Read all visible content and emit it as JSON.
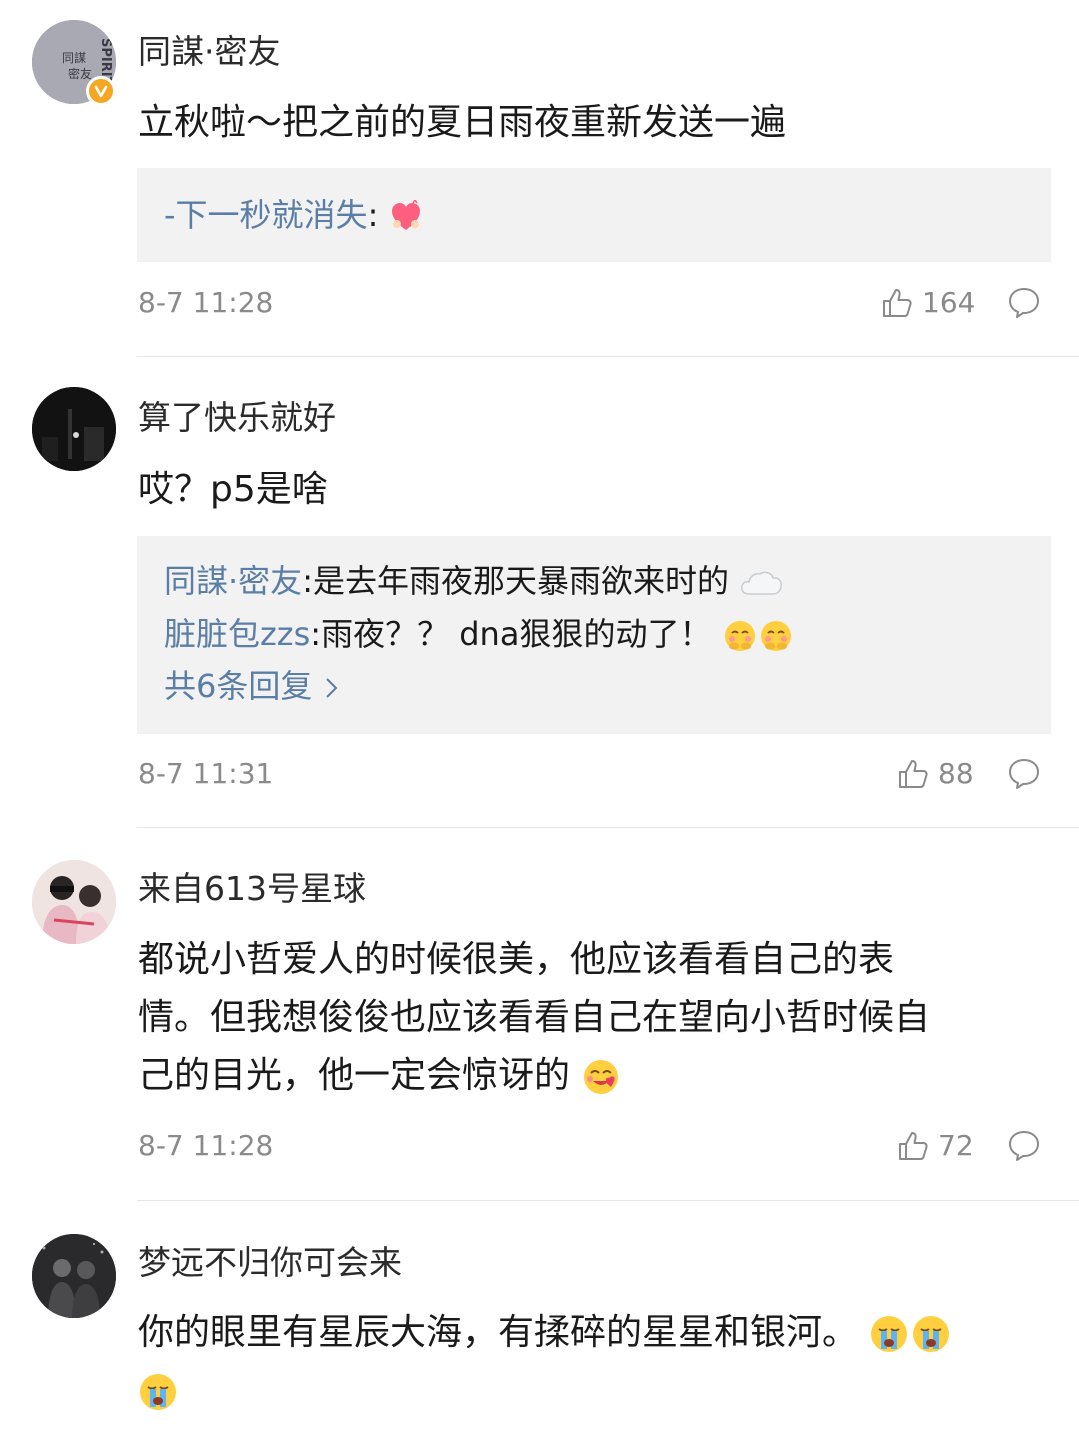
{
  "comments": [
    {
      "username": "同謀·密友",
      "text": "立秋啦～把之前的夏日雨夜重新发送一遍",
      "replies": [
        {
          "name": "-下一秒就消失",
          "text": ":"
        }
      ],
      "time": "8-7 11:28",
      "likes": "164"
    },
    {
      "username": "算了快乐就好",
      "text": "哎？p5是啥",
      "replies": [
        {
          "name": "同謀·密友",
          "text": ":是去年雨夜那天暴雨欲来时的"
        },
        {
          "name": "脏脏包zzs",
          "text": ":雨夜？？ dna狠狠的动了！"
        }
      ],
      "more_replies": "共6条回复",
      "time": "8-7 11:31",
      "likes": "88"
    },
    {
      "username": "来自613号星球",
      "text_lines": [
        "都说小哲爱人的时候很美，他应该看看自己的表",
        "情。但我想俊俊也应该看看自己在望向小哲时候自",
        "己的目光，他一定会惊讶的"
      ],
      "time": "8-7 11:28",
      "likes": "72"
    },
    {
      "username": "梦远不归你可会来",
      "text": "你的眼里有星辰大海，有揉碎的星星和银河。"
    }
  ],
  "avatar0_text": [
    "SPIRIT",
    "同謀",
    "密友"
  ],
  "icons": [
    "verified-badge-icon",
    "like-icon",
    "reply-icon",
    "heart-emoji-icon",
    "cloud-emoji-icon",
    "shy-emoji-icon",
    "love-emoji-icon",
    "crying-emoji-icon"
  ]
}
